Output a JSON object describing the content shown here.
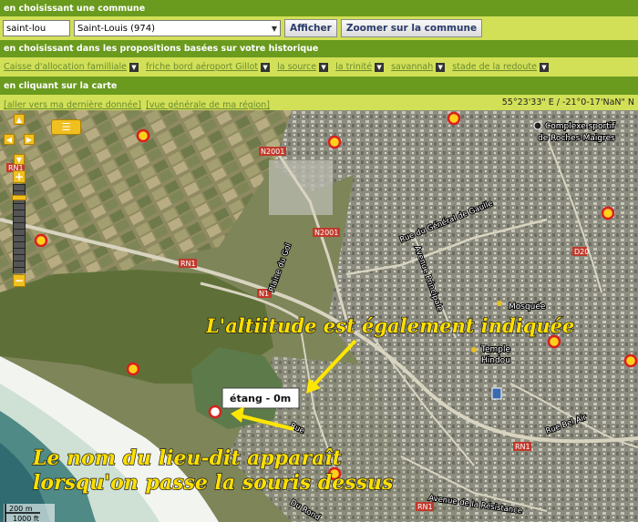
{
  "section1": {
    "title": "en choisissant une commune"
  },
  "commune": {
    "search_value": "saint-lou",
    "selected": "Saint-Louis (974)",
    "show_button": "Afficher",
    "zoom_button": "Zoomer sur la commune"
  },
  "section2": {
    "title": "en choisissant dans les propositions basées sur votre historique"
  },
  "history": [
    {
      "label": "Caisse d'allocation familliale"
    },
    {
      "label": "friche bord aéroport Gillot"
    },
    {
      "label": "la source"
    },
    {
      "label": "la trinité"
    },
    {
      "label": "savannah"
    },
    {
      "label": "stade de la redoute"
    }
  ],
  "section3": {
    "title": "en cliquant sur la carte"
  },
  "links": {
    "last_data": "[aller vers ma dernière donnée]",
    "region_view": "[vue générale de ma région]"
  },
  "coords": "55°23'33\" E / -21°0-17'NaN\" N",
  "map": {
    "tooltip": "étang - 0m",
    "annotation_top": "L'altiitude est également indiquée",
    "annotation_bottom_1": "Le nom du lieu-dit apparaît",
    "annotation_bottom_2": "lorsqu'on passe la souris dessus",
    "scale_m": "200 m",
    "scale_ft": "1000 ft",
    "roads": {
      "plaine": "Plaine du Gol",
      "avenue_principale": "Avenue Principale",
      "general_gaulle": "Rue du Général de Gaulle",
      "bel_air": "Rue Bel Air",
      "resistance": "Avenue de la Résistance",
      "rue": "Rue",
      "du_rond": "Du Rond"
    },
    "route_labels": {
      "n2001": "N2001",
      "n2001b": "N2001",
      "rn1": "RN1",
      "n1": "N1",
      "d20": "D20"
    },
    "poi": {
      "complexe": "Complexe sportif",
      "roches": "de Roches-Maigres",
      "mosquee": "Mosquée",
      "temple": "Temple",
      "hindou": "Hindou"
    }
  }
}
